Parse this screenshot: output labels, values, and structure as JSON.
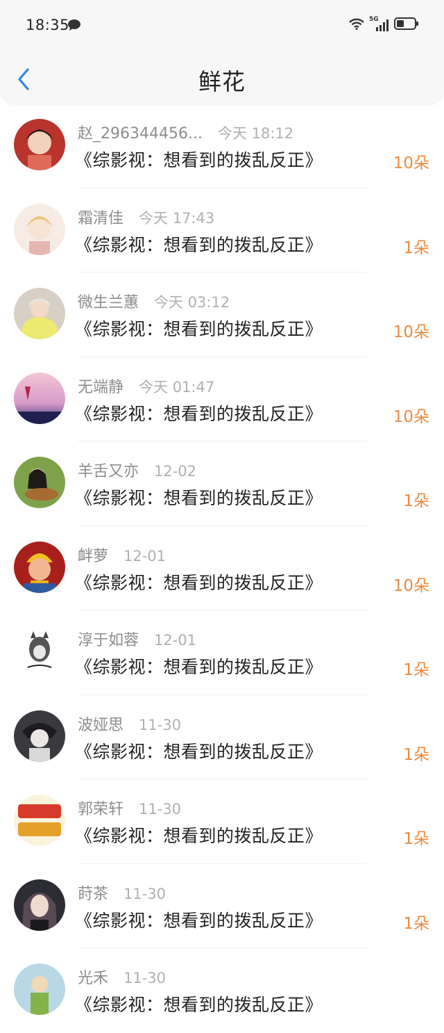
{
  "status_bar": {
    "time": "18:35",
    "network": "5G"
  },
  "header": {
    "title": "鲜花"
  },
  "items": [
    {
      "name": "赵_296344456...",
      "time": "今天 18:12",
      "book": "《综影视：想看到的拨乱反正》",
      "count": "10朵"
    },
    {
      "name": "霜清佳",
      "time": "今天 17:43",
      "book": "《综影视：想看到的拨乱反正》",
      "count": "1朵"
    },
    {
      "name": "微生兰蕙",
      "time": "今天 03:12",
      "book": "《综影视：想看到的拨乱反正》",
      "count": "10朵"
    },
    {
      "name": "无端静",
      "time": "今天 01:47",
      "book": "《综影视：想看到的拨乱反正》",
      "count": "10朵"
    },
    {
      "name": "羊舌又亦",
      "time": "12-02",
      "book": "《综影视：想看到的拨乱反正》",
      "count": "1朵"
    },
    {
      "name": "衅萝",
      "time": "12-01",
      "book": "《综影视：想看到的拨乱反正》",
      "count": "10朵"
    },
    {
      "name": "淳于如蓉",
      "time": "12-01",
      "book": "《综影视：想看到的拨乱反正》",
      "count": "1朵"
    },
    {
      "name": "波娅思",
      "time": "11-30",
      "book": "《综影视：想看到的拨乱反正》",
      "count": "1朵"
    },
    {
      "name": "郭荣轩",
      "time": "11-30",
      "book": "《综影视：想看到的拨乱反正》",
      "count": "1朵"
    },
    {
      "name": "莳茶",
      "time": "11-30",
      "book": "《综影视：想看到的拨乱反正》",
      "count": "1朵"
    },
    {
      "name": "光禾",
      "time": "11-30",
      "book": "《综影视：想看到的拨乱反正》",
      "count": ""
    }
  ],
  "colors": {
    "accent_back": "#2f86e6",
    "count": "#ee8a3f"
  }
}
